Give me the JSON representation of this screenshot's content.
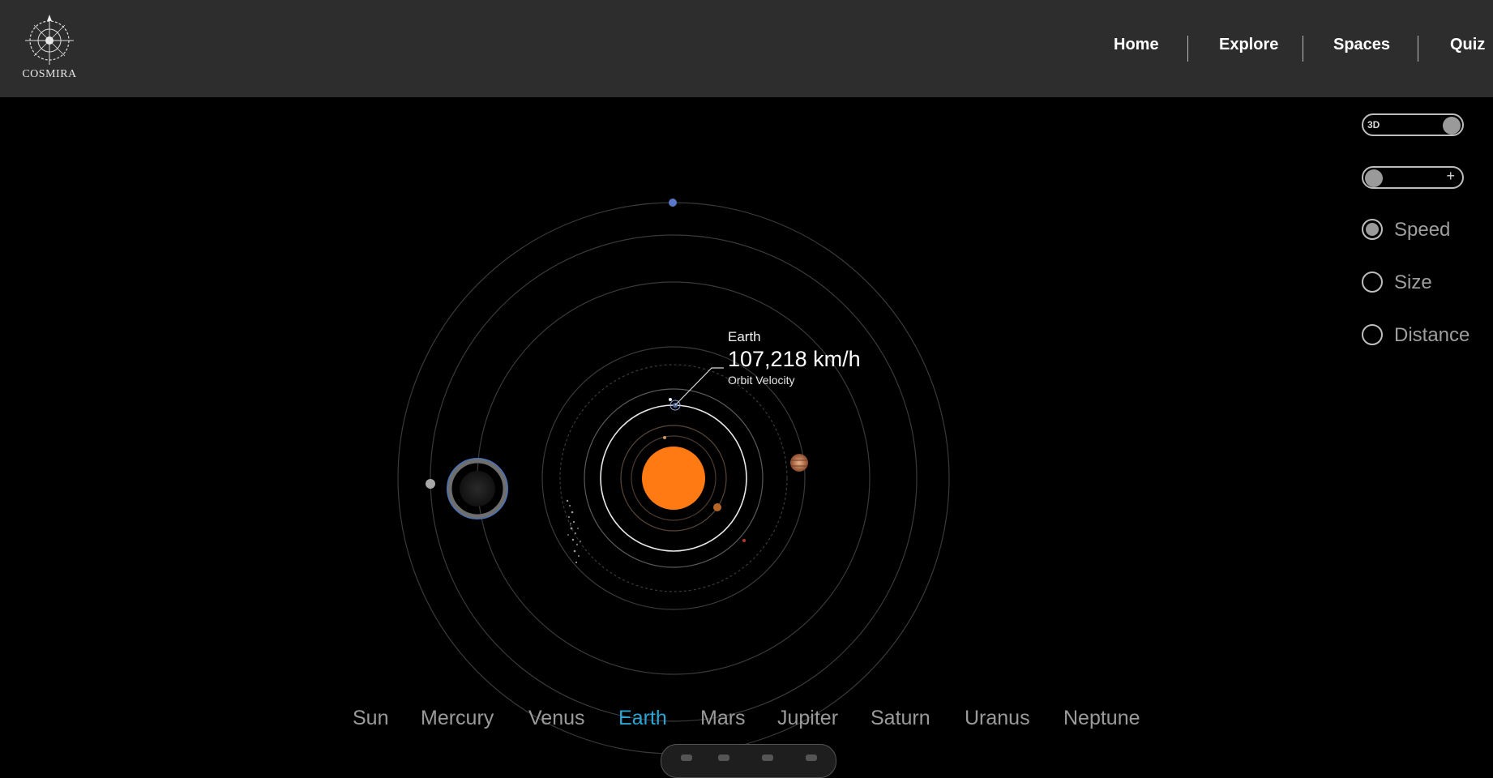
{
  "app": {
    "logo_text": "COSMIRA"
  },
  "nav": {
    "items": [
      {
        "label": "Home"
      },
      {
        "label": "Explore"
      },
      {
        "label": "Spaces"
      },
      {
        "label": "Quiz"
      }
    ]
  },
  "selected_planet": {
    "name": "Earth",
    "velocity": "107,218 km/h",
    "velocity_caption": "Orbit Velocity"
  },
  "controls": {
    "toggle_3d_label": "3D",
    "toggle_3d_on": true,
    "zoom_symbol": "+",
    "zoom_on": false,
    "radio_options": [
      {
        "label": "Speed",
        "selected": true
      },
      {
        "label": "Size",
        "selected": false
      },
      {
        "label": "Distance",
        "selected": false
      }
    ]
  },
  "planet_nav": {
    "items": [
      {
        "label": "Sun",
        "active": false
      },
      {
        "label": "Mercury",
        "active": false
      },
      {
        "label": "Venus",
        "active": false
      },
      {
        "label": "Earth",
        "active": true
      },
      {
        "label": "Mars",
        "active": false
      },
      {
        "label": "Jupiter",
        "active": false
      },
      {
        "label": "Saturn",
        "active": false
      },
      {
        "label": "Uranus",
        "active": false
      },
      {
        "label": "Neptune",
        "active": false
      }
    ],
    "active_color": "#29a6d6",
    "inactive_color": "#9a9a9a"
  },
  "colors": {
    "topbar": "#2d2d2d",
    "background": "#000000",
    "sun": "#ff7a12",
    "orbit": "#3a3a3a"
  },
  "icons": [
    "compass-logo-icon",
    "plus-icon"
  ]
}
